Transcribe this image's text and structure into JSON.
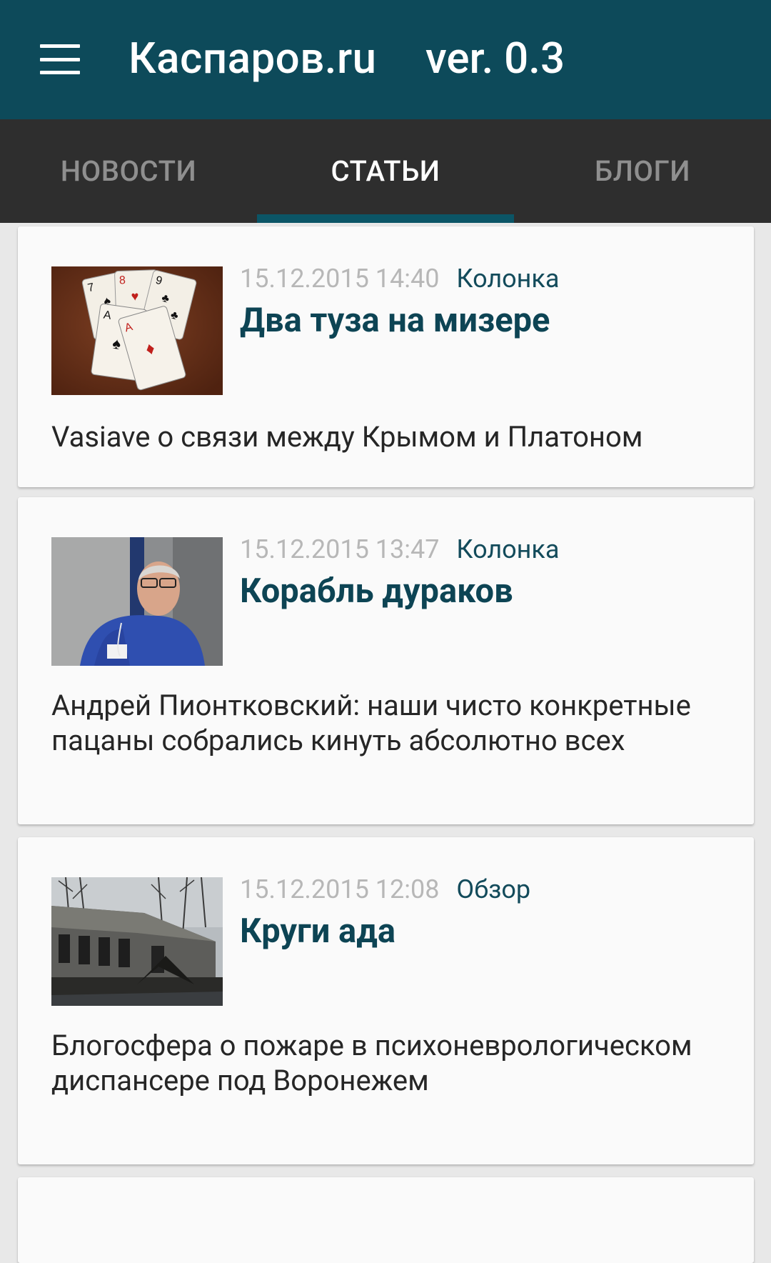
{
  "appbar": {
    "title": "Каспаров.ru",
    "version": "ver. 0.3",
    "menu_icon": "hamburger-menu-icon",
    "background": "#0d4a5a"
  },
  "tabs": [
    {
      "label": "НОВОСТИ",
      "active": false
    },
    {
      "label": "СТАТЬИ",
      "active": true
    },
    {
      "label": "БЛОГИ",
      "active": false
    }
  ],
  "articles": [
    {
      "date": "15.12.2015 14:40",
      "category": "Колонка",
      "title": "Два туза на мизере",
      "summary": "Vasiave о связи между Крымом и Платоном",
      "thumbnail": "playing-cards-photo"
    },
    {
      "date": "15.12.2015 13:47",
      "category": "Колонка",
      "title": "Корабль дураков",
      "summary": "Андрей Пионтковский: наши чисто конкретные пацаны собрались кинуть абсолютно всех",
      "thumbnail": "man-in-blue-sweater-photo"
    },
    {
      "date": "15.12.2015 12:08",
      "category": "Обзор",
      "title": "Круги ада",
      "summary": "Блогосфера о пожаре в психоневрологическом диспансере под Воронежем",
      "thumbnail": "burned-building-photo"
    }
  ]
}
